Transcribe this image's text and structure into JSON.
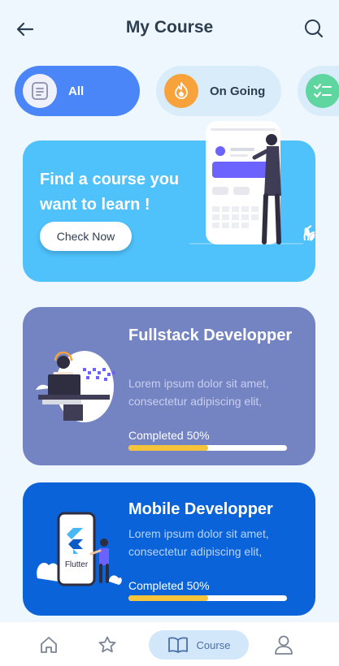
{
  "header": {
    "title": "My Course"
  },
  "filters": [
    {
      "label": "All",
      "icon": "list-doc-icon",
      "selected": true
    },
    {
      "label": "On Going",
      "icon": "flame-icon",
      "selected": false
    },
    {
      "label": "",
      "icon": "checklist-icon",
      "selected": false
    }
  ],
  "promo": {
    "text": "Find a course you want to learn !",
    "button_label": "Check Now"
  },
  "courses": [
    {
      "title": "Fullstack Developper",
      "description": "Lorem ipsum dolor sit amet, consectetur adipiscing elit,",
      "progress_label": "Completed 50%",
      "progress": 0.5,
      "color": "#7483c2"
    },
    {
      "title": "Mobile Developper",
      "description": "Lorem ipsum dolor sit amet, consectetur adipiscing elit,",
      "progress_label": "Completed 50%",
      "progress": 0.5,
      "color": "#0b63d9",
      "illustration_text": "Flutter"
    }
  ],
  "bottom_nav": {
    "items": [
      {
        "icon": "home-icon",
        "label": ""
      },
      {
        "icon": "star-icon",
        "label": ""
      },
      {
        "icon": "book-icon",
        "label": "Course",
        "active": true
      },
      {
        "icon": "user-icon",
        "label": ""
      }
    ]
  },
  "colors": {
    "background": "#eef7fd",
    "accent": "#4a86f7",
    "promo": "#4fc1fb",
    "progress": "#f6c43a"
  }
}
